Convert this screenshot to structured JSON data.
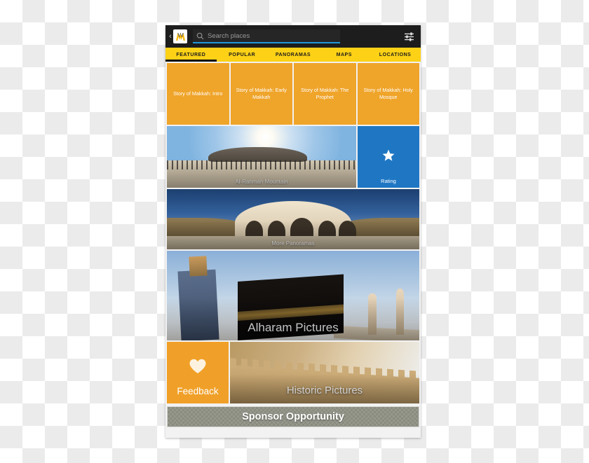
{
  "app": {
    "logo_icon": "makkah-logo-icon",
    "back_caret": "‹"
  },
  "search": {
    "icon": "search-icon",
    "value": "",
    "placeholder": "Search places"
  },
  "toolbar": {
    "filter_icon": "sliders-filter-icon"
  },
  "tabs": [
    {
      "label": "FEATURED",
      "active": true
    },
    {
      "label": "POPULAR",
      "active": false
    },
    {
      "label": "PANORAMAS",
      "active": false
    },
    {
      "label": "MAPS",
      "active": false
    },
    {
      "label": "LOCATIONS",
      "active": false
    }
  ],
  "stories": [
    {
      "title": "Story of Makkah: Intro"
    },
    {
      "title": "Story of Makkah: Early Makkah"
    },
    {
      "title": "Story of Makkah: The Prophet"
    },
    {
      "title": "Story of Makkah: Holy Mosque"
    }
  ],
  "mountain": {
    "caption": "Al-Rahmah Mountain"
  },
  "rating": {
    "label": "Rating",
    "icon": "star-icon",
    "color": "#1f77c4"
  },
  "panorama": {
    "caption": "More Panoramas"
  },
  "alharam": {
    "title": "Alharam Pictures"
  },
  "feedback": {
    "label": "Feedback",
    "icon": "heart-icon",
    "color": "#f0a028"
  },
  "historic": {
    "title": "Historic Pictures"
  },
  "sponsor": {
    "label": "Sponsor Opportunity",
    "color": "#8b8c80"
  },
  "theme": {
    "tab_bar": "#fcd116",
    "story_tile": "#efa42a",
    "top_bar": "#1d1d1d",
    "search_underline": "#2196d9"
  }
}
